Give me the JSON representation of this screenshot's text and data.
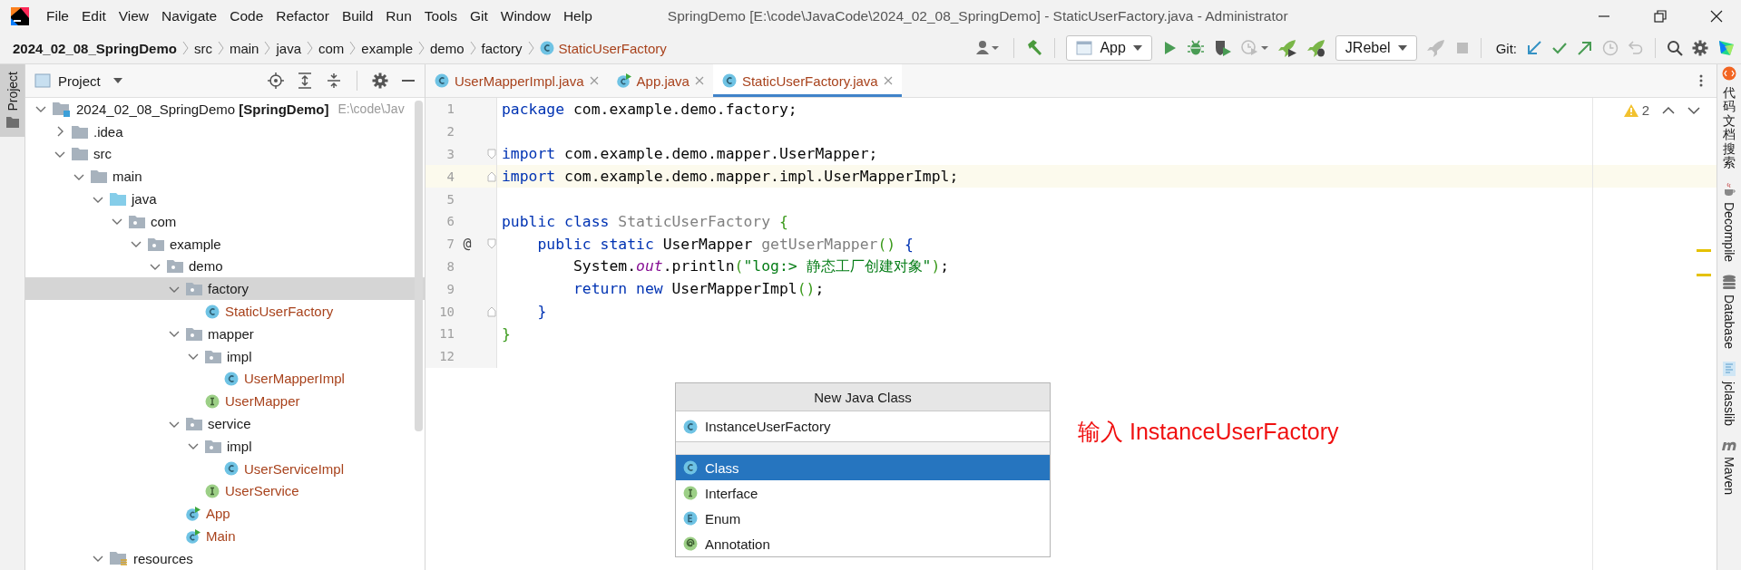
{
  "window": {
    "title": "SpringDemo [E:\\code\\JavaCode\\2024_02_08_SpringDemo] - StaticUserFactory.java - Administrator"
  },
  "menu": [
    "File",
    "Edit",
    "View",
    "Navigate",
    "Code",
    "Refactor",
    "Build",
    "Run",
    "Tools",
    "Git",
    "Window",
    "Help"
  ],
  "breadcrumbs": [
    {
      "label": "2024_02_08_SpringDemo",
      "kind": "project"
    },
    {
      "label": "src",
      "kind": "folder"
    },
    {
      "label": "main",
      "kind": "folder"
    },
    {
      "label": "java",
      "kind": "folder"
    },
    {
      "label": "com",
      "kind": "folder"
    },
    {
      "label": "example",
      "kind": "folder"
    },
    {
      "label": "demo",
      "kind": "folder"
    },
    {
      "label": "factory",
      "kind": "folder"
    },
    {
      "label": "StaticUserFactory",
      "kind": "class"
    }
  ],
  "toolbar": [
    {
      "kind": "user"
    },
    {
      "kind": "build"
    },
    {
      "kind": "dropdown",
      "label": "App"
    },
    {
      "kind": "run"
    },
    {
      "kind": "debug"
    },
    {
      "kind": "coverage"
    },
    {
      "kind": "profile",
      "disabled": true
    },
    {
      "kind": "rocket"
    },
    {
      "kind": "rocketdebug"
    },
    {
      "kind": "dropdown",
      "label": "JRebel"
    },
    {
      "kind": "rocket",
      "disabled": true
    },
    {
      "kind": "stop",
      "disabled": true
    },
    {
      "kind": "label",
      "label": "Git:"
    },
    {
      "kind": "update"
    },
    {
      "kind": "commit"
    },
    {
      "kind": "push"
    },
    {
      "kind": "history",
      "disabled": true
    },
    {
      "kind": "rollback",
      "disabled": true
    },
    {
      "kind": "search"
    },
    {
      "kind": "settings"
    },
    {
      "kind": "logo"
    }
  ],
  "left_strip": {
    "label": "Project"
  },
  "project_panel": {
    "title": "Project",
    "tree": [
      {
        "label": "2024_02_08_SpringDemo **[SpringDemo]**",
        "path": "E:\\code\\Jav",
        "kind": "module",
        "expanded": true,
        "selected": false,
        "children": [
          {
            "label": ".idea",
            "kind": "folder",
            "expanded": false,
            "selected": false
          },
          {
            "label": "src",
            "kind": "folder",
            "expanded": true,
            "selected": false,
            "children": [
              {
                "label": "main",
                "kind": "folder",
                "expanded": true,
                "selected": false,
                "children": [
                  {
                    "label": "java",
                    "kind": "source",
                    "expanded": true,
                    "selected": false,
                    "children": [
                      {
                        "label": "com",
                        "kind": "package",
                        "expanded": true,
                        "selected": false,
                        "children": [
                          {
                            "label": "example",
                            "kind": "package",
                            "expanded": true,
                            "selected": false,
                            "children": [
                              {
                                "label": "demo",
                                "kind": "package",
                                "expanded": true,
                                "selected": false,
                                "children": [
                                  {
                                    "label": "factory",
                                    "kind": "package",
                                    "expanded": true,
                                    "selected": true,
                                    "children": [
                                      {
                                        "label": "StaticUserFactory",
                                        "kind": "class",
                                        "color": "#a8421c",
                                        "selected": false
                                      }
                                    ]
                                  },
                                  {
                                    "label": "mapper",
                                    "kind": "package",
                                    "expanded": true,
                                    "selected": false,
                                    "children": [
                                      {
                                        "label": "impl",
                                        "kind": "package",
                                        "expanded": true,
                                        "selected": false,
                                        "children": [
                                          {
                                            "label": "UserMapperImpl",
                                            "kind": "class",
                                            "color": "#a8421c",
                                            "selected": false
                                          }
                                        ]
                                      },
                                      {
                                        "label": "UserMapper",
                                        "kind": "interface",
                                        "color": "#a8421c",
                                        "selected": false
                                      }
                                    ]
                                  },
                                  {
                                    "label": "service",
                                    "kind": "package",
                                    "expanded": true,
                                    "selected": false,
                                    "children": [
                                      {
                                        "label": "impl",
                                        "kind": "package",
                                        "expanded": true,
                                        "selected": false,
                                        "children": [
                                          {
                                            "label": "UserServiceImpl",
                                            "kind": "class",
                                            "color": "#a8421c",
                                            "selected": false
                                          }
                                        ]
                                      },
                                      {
                                        "label": "UserService",
                                        "kind": "interface",
                                        "color": "#a8421c",
                                        "selected": false
                                      }
                                    ]
                                  },
                                  {
                                    "label": "App",
                                    "kind": "mainclass",
                                    "color": "#a8421c",
                                    "selected": false
                                  },
                                  {
                                    "label": "Main",
                                    "kind": "mainclass",
                                    "color": "#a8421c",
                                    "selected": false
                                  }
                                ]
                              }
                            ]
                          }
                        ]
                      }
                    ]
                  },
                  {
                    "label": "resources",
                    "kind": "resources",
                    "expanded": true,
                    "selected": false
                  }
                ]
              }
            ]
          }
        ]
      }
    ]
  },
  "editor": {
    "tabs": [
      {
        "label": "UserMapperImpl.java",
        "kind": "class",
        "selected": false
      },
      {
        "label": "App.java",
        "kind": "mainclass",
        "selected": false
      },
      {
        "label": "StaticUserFactory.java",
        "kind": "class",
        "selected": true
      }
    ],
    "warnings": "2",
    "lines": [
      {
        "number": "1",
        "current": false,
        "tokens": [
          {
            "kind": "keyword",
            "text": "package"
          },
          {
            "kind": "text",
            "text": " com.example.demo.factory;"
          }
        ]
      },
      {
        "number": "2",
        "current": false
      },
      {
        "number": "3",
        "current": false,
        "fold_start": true,
        "tokens": [
          {
            "kind": "keyword",
            "text": "import"
          },
          {
            "kind": "text",
            "text": " com.example.demo.mapper.UserMapper;"
          }
        ]
      },
      {
        "number": "4",
        "current": true,
        "fold_end": true,
        "tokens": [
          {
            "kind": "keyword",
            "text": "import"
          },
          {
            "kind": "text",
            "text": " com.example.demo.mapper.impl.UserMapperImpl;"
          }
        ]
      },
      {
        "number": "5",
        "current": false
      },
      {
        "number": "6",
        "current": false,
        "tokens": [
          {
            "kind": "keyword",
            "text": "public class"
          },
          {
            "kind": "unused",
            "text": " StaticUserFactory "
          },
          {
            "kind": "green",
            "text": "{"
          }
        ]
      },
      {
        "number": "7",
        "current": false,
        "fold_start": true,
        "marker": "@",
        "tokens": [
          {
            "kind": "keyword",
            "text": "    public static"
          },
          {
            "kind": "text",
            "text": " UserMapper "
          },
          {
            "kind": "unused",
            "text": "getUserMapper"
          },
          {
            "kind": "green",
            "text": "()"
          },
          {
            "kind": "blue",
            "text": " {"
          }
        ]
      },
      {
        "number": "8",
        "current": false,
        "tokens": [
          {
            "kind": "text",
            "text": "        System."
          },
          {
            "kind": "field",
            "text": "out"
          },
          {
            "kind": "text",
            "text": ".println"
          },
          {
            "kind": "green",
            "text": "("
          },
          {
            "kind": "string",
            "text": "\"log:> 静态工厂创建对象\""
          },
          {
            "kind": "green",
            "text": ")"
          },
          {
            "kind": "text",
            "text": ";"
          }
        ]
      },
      {
        "number": "9",
        "current": false,
        "tokens": [
          {
            "kind": "keyword",
            "text": "        return new"
          },
          {
            "kind": "text",
            "text": " UserMapperImpl"
          },
          {
            "kind": "green",
            "text": "()"
          },
          {
            "kind": "text",
            "text": ";"
          }
        ]
      },
      {
        "number": "10",
        "current": false,
        "fold_end": true,
        "tokens": [
          {
            "kind": "blue",
            "text": "    }"
          }
        ]
      },
      {
        "number": "11",
        "current": false,
        "tokens": [
          {
            "kind": "green",
            "text": "}"
          }
        ]
      },
      {
        "number": "12",
        "current": false
      }
    ]
  },
  "popup": {
    "title": "New Java Class",
    "value": "InstanceUserFactory",
    "items": [
      {
        "label": "Class",
        "kind": "class",
        "selected": true
      },
      {
        "label": "Interface",
        "kind": "interface",
        "selected": false
      },
      {
        "label": "Enum",
        "kind": "enum",
        "selected": false
      },
      {
        "label": "Annotation",
        "kind": "annotation",
        "selected": false
      }
    ]
  },
  "annotation": "输入 InstanceUserFactory",
  "right_strip": [
    {
      "label": "代码文档搜索",
      "kind": "search"
    },
    {
      "label": "Decompile",
      "kind": "cup"
    },
    {
      "label": "Database",
      "kind": "database"
    },
    {
      "label": "jclasslib",
      "kind": "jclass"
    },
    {
      "label": "Maven",
      "kind": "maven"
    }
  ]
}
